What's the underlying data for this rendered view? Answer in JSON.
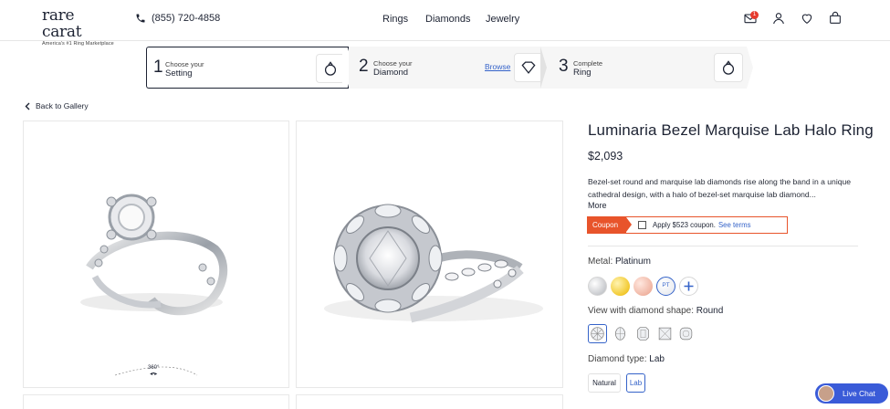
{
  "header": {
    "logo_text": "rare carat",
    "logo_tagline": "America's #1 Ring Marketplace",
    "phone": "(855) 720-4858",
    "nav": [
      "Rings",
      "Diamonds",
      "Jewelry"
    ],
    "icons": [
      "mail-icon",
      "user-icon",
      "heart-icon",
      "bag-icon"
    ],
    "mail_badge": "1"
  },
  "stepper": {
    "steps": [
      {
        "num": "1",
        "small": "Choose your",
        "big": "Setting"
      },
      {
        "num": "2",
        "small": "Choose your",
        "big": "Diamond",
        "action": "Browse"
      },
      {
        "num": "3",
        "small": "Complete",
        "big": "Ring"
      }
    ]
  },
  "back_label": "Back to Gallery",
  "gallery": {
    "rotate_label": "360°"
  },
  "product": {
    "title": "Luminaria Bezel Marquise Lab Halo Ring",
    "price": "$2,093",
    "description": "Bezel-set round and marquise lab diamonds rise along the band in a unique cathedral design, with a halo of bezel-set marquise lab diamond...",
    "more": "More",
    "coupon": {
      "tag": "Coupon",
      "text": "Apply $523 coupon.",
      "link": "See terms"
    },
    "metal": {
      "label": "Metal:",
      "value": "Platinum",
      "pt_label": "PT"
    },
    "shape": {
      "label": "View with diamond shape:",
      "value": "Round"
    },
    "diamond_type": {
      "label": "Diamond type:",
      "value": "Lab",
      "options": [
        "Natural",
        "Lab"
      ],
      "selected": "Lab"
    }
  },
  "chat_label": "Live Chat",
  "colors": {
    "accent": "#3563c9",
    "coupon": "#e8542b",
    "chat": "#3a5bd8",
    "text": "#1d2333"
  }
}
